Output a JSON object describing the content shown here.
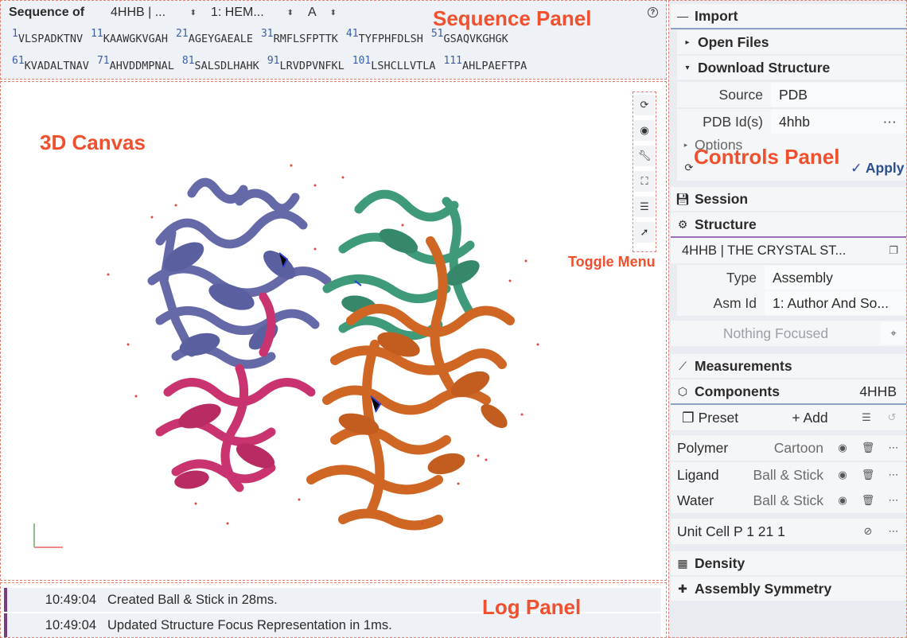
{
  "sequence": {
    "label": "Sequence of",
    "entry": "4HHB | ...",
    "chain_select": "1: HEM...",
    "sub_select": "A",
    "rows": [
      [
        {
          "num": "1",
          "seq": "VLSPADKTNV"
        },
        {
          "num": "11",
          "seq": "KAAWGKVGAH"
        },
        {
          "num": "21",
          "seq": "AGEYGAEALE"
        },
        {
          "num": "31",
          "seq": "RMFLSFPTTK"
        },
        {
          "num": "41",
          "seq": "TYFPHFDLSH"
        },
        {
          "num": "51",
          "seq": "GSAQVKGHGK"
        }
      ],
      [
        {
          "num": "61",
          "seq": "KVADALTNAV"
        },
        {
          "num": "71",
          "seq": "AHVDDMPNAL"
        },
        {
          "num": "81",
          "seq": "SALSDLHAHK"
        },
        {
          "num": "91",
          "seq": "LRVDPVNFKL"
        },
        {
          "num": "101",
          "seq": "LSHCLLVTLA"
        },
        {
          "num": "111",
          "seq": "AHLPAEFTPA"
        }
      ]
    ]
  },
  "annotations": {
    "sequence_panel": "Sequence Panel",
    "canvas": "3D Canvas",
    "toggle_menu": "Toggle Menu",
    "controls_panel": "Controls Panel",
    "log_panel": "Log Panel"
  },
  "log": [
    {
      "time": "10:49:04",
      "message": "Created Ball & Stick in 28ms."
    },
    {
      "time": "10:49:04",
      "message": "Updated Structure Focus Representation in 1ms."
    }
  ],
  "controls": {
    "import": "Import",
    "open_files": "Open Files",
    "download_structure": "Download Structure",
    "source_label": "Source",
    "source_value": "PDB",
    "pdb_ids_label": "PDB Id(s)",
    "pdb_ids_value": "4hhb",
    "options": "Options",
    "apply": "Apply",
    "session": "Session",
    "structure": "Structure",
    "structure_name": "4HHB | THE CRYSTAL ST...",
    "type_label": "Type",
    "type_value": "Assembly",
    "asm_label": "Asm Id",
    "asm_value": "1: Author And So...",
    "nothing_focused": "Nothing Focused",
    "measurements": "Measurements",
    "components": "Components",
    "components_id": "4HHB",
    "preset": "Preset",
    "add": "Add",
    "component_rows": [
      {
        "name": "Polymer",
        "rep": "Cartoon"
      },
      {
        "name": "Ligand",
        "rep": "Ball & Stick"
      },
      {
        "name": "Water",
        "rep": "Ball & Stick"
      }
    ],
    "unit_cell": "Unit Cell P 1 21 1",
    "density": "Density",
    "assembly_symmetry": "Assembly Symmetry"
  },
  "colors": {
    "annotation": "#f0502d",
    "chain_a": "#6569a8",
    "chain_b": "#3e9a78",
    "chain_c": "#c9336f",
    "chain_d": "#d06624",
    "accent_link": "#3a5fa8"
  }
}
